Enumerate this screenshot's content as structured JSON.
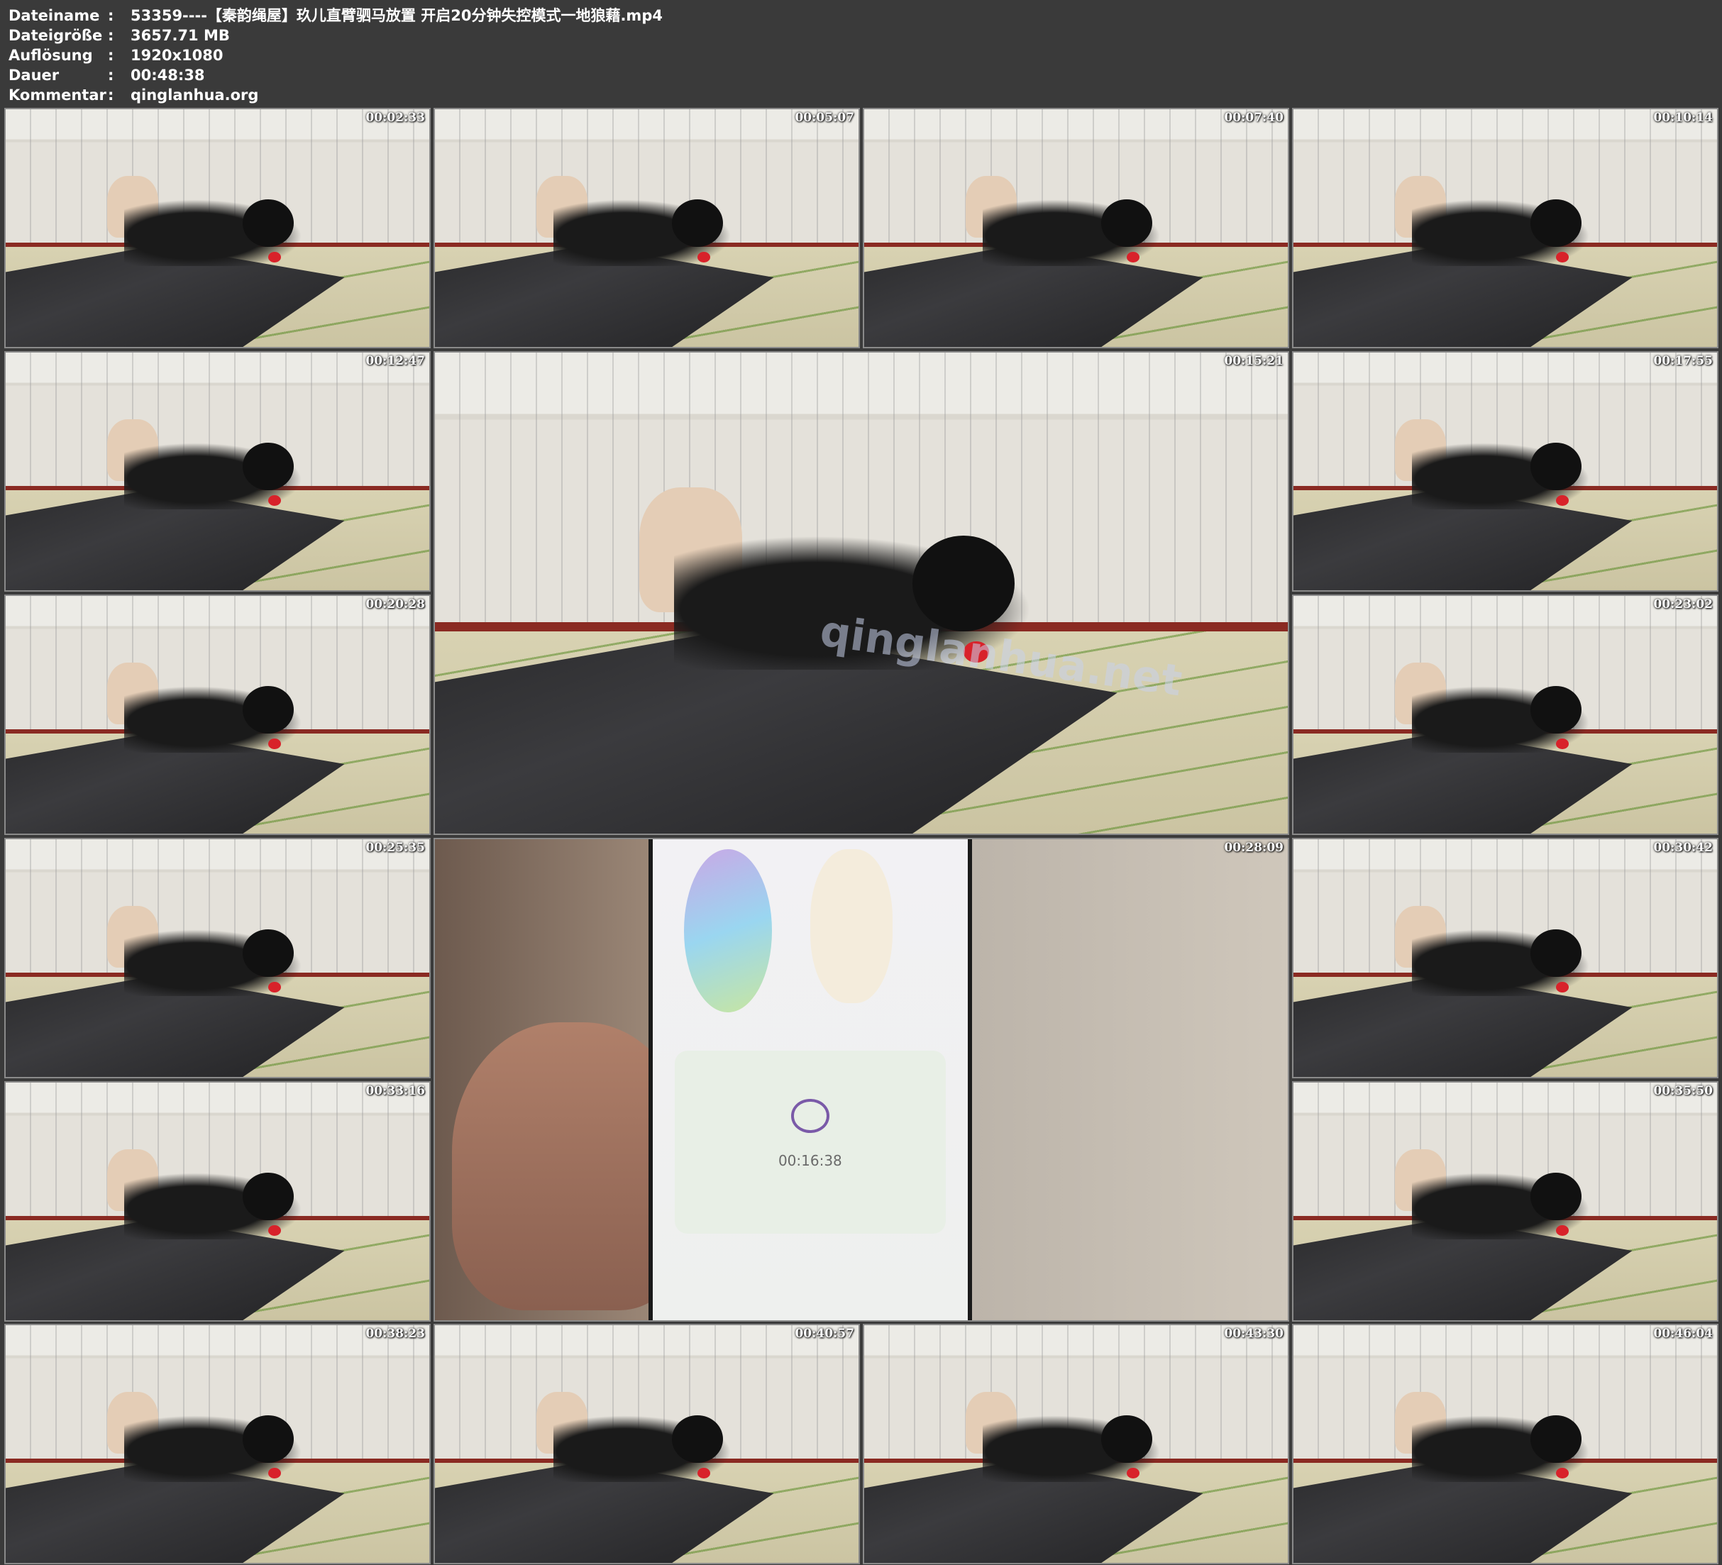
{
  "file_info": [
    {
      "label": "Dateiname",
      "sep": ":",
      "value": "53359----【秦韵绳屋】玖儿直臂驷马放置 开启20分钟失控模式一地狼藉.mp4"
    },
    {
      "label": "Dateigröße",
      "sep": ":",
      "value": "3657.71 MB"
    },
    {
      "label": "Auflösung",
      "sep": ":",
      "value": "1920x1080"
    },
    {
      "label": "Dauer",
      "sep": ":",
      "value": "00:48:38"
    },
    {
      "label": "Kommentar",
      "sep": ":",
      "value": "qinglanhua.org"
    }
  ],
  "thumbnails": [
    {
      "timestamp": "00:02:33",
      "scene": "sitting"
    },
    {
      "timestamp": "00:05:07",
      "scene": "lying"
    },
    {
      "timestamp": "00:07:40",
      "scene": "lying"
    },
    {
      "timestamp": "00:10:14",
      "scene": "lying"
    },
    {
      "timestamp": "00:12:47",
      "scene": "lying"
    },
    {
      "timestamp": "00:15:21",
      "scene": "lying-large",
      "watermark": "qinglanhua.net"
    },
    {
      "timestamp": "00:17:55",
      "scene": "lying"
    },
    {
      "timestamp": "00:20:28",
      "scene": "lying"
    },
    {
      "timestamp": "00:23:02",
      "scene": "lying"
    },
    {
      "timestamp": "00:25:35",
      "scene": "lying"
    },
    {
      "timestamp": "00:28:09",
      "scene": "phone-large",
      "phone_timer": "00:16:38"
    },
    {
      "timestamp": "00:30:42",
      "scene": "lying"
    },
    {
      "timestamp": "00:33:16",
      "scene": "lying"
    },
    {
      "timestamp": "00:35:50",
      "scene": "lying"
    },
    {
      "timestamp": "00:38:23",
      "scene": "lying"
    },
    {
      "timestamp": "00:40:57",
      "scene": "lying"
    },
    {
      "timestamp": "00:43:30",
      "scene": "lying"
    },
    {
      "timestamp": "00:46:04",
      "scene": "sitting"
    }
  ]
}
